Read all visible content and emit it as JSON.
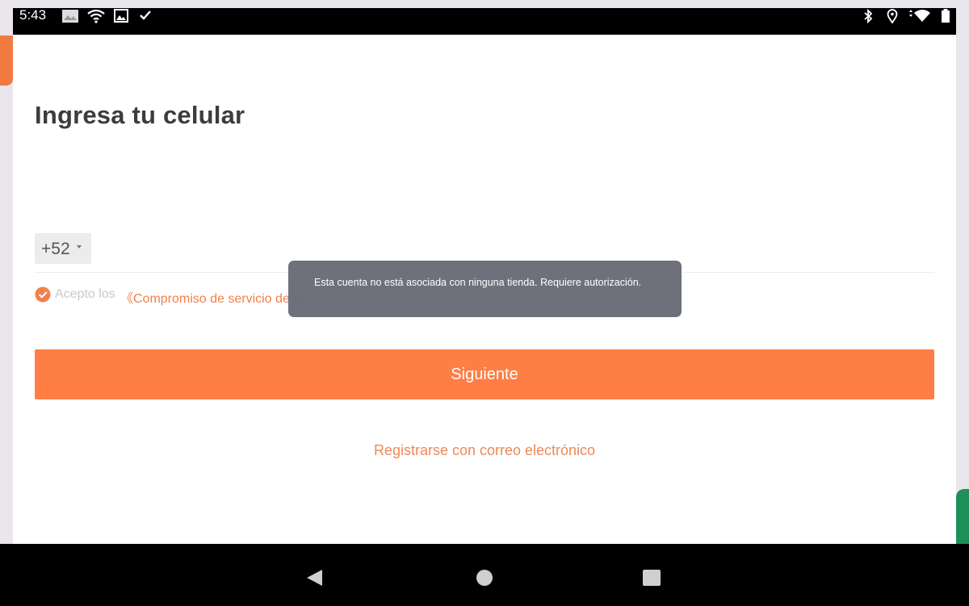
{
  "status_bar": {
    "time": "5:43",
    "left_icons": [
      "notification-image-icon",
      "wifi-icon",
      "gallery-icon",
      "check-icon"
    ],
    "right_icons": [
      "bluetooth-icon",
      "location-icon",
      "wifi-signal-icon",
      "battery-icon"
    ]
  },
  "screen": {
    "title": "Ingresa tu celular",
    "country_code": "+52",
    "agreement_prefix": "Acepto los",
    "agreement_link": "《Compromiso de servicio de re",
    "next_button": "Siguiente",
    "email_register_link": "Registrarse con correo electrónico"
  },
  "toast": {
    "message": "Esta cuenta no está asociada con ninguna tienda. Requiere autorización."
  },
  "colors": {
    "accent": "#fe7e45",
    "link": "#ec8a5a",
    "toast_bg": "#686a76"
  }
}
